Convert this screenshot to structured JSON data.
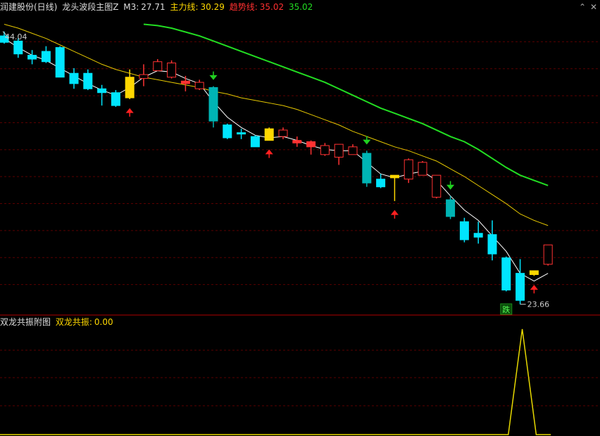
{
  "main_header": {
    "stock": "润建股份(日线)",
    "indicator": "龙头波段主图Z",
    "m3_label": "M3:",
    "m3_value": "27.71",
    "main_label": "主力线:",
    "main_value": "30.29",
    "trend_label": "趋势线:",
    "trend_value": "35.02",
    "trend_value2": "35.02"
  },
  "sub_header": {
    "title": "双龙共振附图",
    "label": "双龙共振:",
    "value": "0.00"
  },
  "colors": {
    "bull": "#ff3232",
    "bear": "#00e5ff",
    "bear_dark": "#00b4b4",
    "breakout": "#ffd700",
    "ma_white": "#ffffff",
    "ma_yellow": "#e6c800",
    "ma_green": "#22dd22",
    "grid": "#5a0000",
    "signal_up": "#ff2020",
    "signal_down": "#20d020"
  },
  "chart_data": {
    "type": "candlestick",
    "y_range": [
      22.5,
      45.5
    ],
    "price_high_label": "44.04",
    "price_low_label": "23.66",
    "fall_badge": "跌",
    "candles": [
      {
        "o": 43.7,
        "c": 43.2,
        "h": 44.04,
        "l": 43.1,
        "k": "bear"
      },
      {
        "o": 43.3,
        "c": 42.3,
        "h": 43.5,
        "l": 42.0,
        "k": "bear"
      },
      {
        "o": 42.2,
        "c": 41.9,
        "h": 42.6,
        "l": 41.5,
        "k": "bear"
      },
      {
        "o": 42.5,
        "c": 41.7,
        "h": 42.9,
        "l": 41.6,
        "k": "bear"
      },
      {
        "o": 42.8,
        "c": 40.5,
        "h": 42.9,
        "l": 40.5,
        "k": "bear"
      },
      {
        "o": 40.8,
        "c": 40.0,
        "h": 41.2,
        "l": 39.6,
        "k": "bear"
      },
      {
        "o": 40.8,
        "c": 39.6,
        "h": 41.1,
        "l": 39.5,
        "k": "bear"
      },
      {
        "o": 39.6,
        "c": 39.3,
        "h": 39.9,
        "l": 38.3,
        "k": "bear"
      },
      {
        "o": 39.3,
        "c": 38.3,
        "h": 39.5,
        "l": 38.2,
        "k": "bear"
      },
      {
        "o": 38.9,
        "c": 40.5,
        "h": 41.1,
        "l": 38.8,
        "k": "breakout"
      },
      {
        "o": 40.4,
        "c": 40.7,
        "h": 41.5,
        "l": 39.8,
        "k": "bull"
      },
      {
        "o": 41.0,
        "c": 41.7,
        "h": 41.9,
        "l": 41.0,
        "k": "bull"
      },
      {
        "o": 41.6,
        "c": 40.5,
        "h": 41.8,
        "l": 40.4,
        "k": "bear_hollow"
      },
      {
        "o": 40.2,
        "c": 40.0,
        "h": 40.6,
        "l": 39.4,
        "k": "bull_thin"
      },
      {
        "o": 39.6,
        "c": 40.1,
        "h": 40.3,
        "l": 39.5,
        "k": "bull"
      },
      {
        "o": 39.7,
        "c": 37.1,
        "h": 39.8,
        "l": 36.6,
        "k": "bear_dark"
      },
      {
        "o": 36.8,
        "c": 35.8,
        "h": 36.9,
        "l": 35.7,
        "k": "bear"
      },
      {
        "o": 36.2,
        "c": 36.1,
        "h": 36.5,
        "l": 35.7,
        "k": "bear"
      },
      {
        "o": 35.9,
        "c": 35.1,
        "h": 36.0,
        "l": 35.1,
        "k": "bear"
      },
      {
        "o": 35.6,
        "c": 36.5,
        "h": 36.6,
        "l": 35.6,
        "k": "breakout"
      },
      {
        "o": 35.9,
        "c": 36.4,
        "h": 36.6,
        "l": 35.7,
        "k": "bull"
      },
      {
        "o": 35.6,
        "c": 35.4,
        "h": 35.9,
        "l": 35.1,
        "k": "bull_thin"
      },
      {
        "o": 35.5,
        "c": 35.1,
        "h": 35.6,
        "l": 34.5,
        "k": "bull_thin"
      },
      {
        "o": 35.2,
        "c": 34.5,
        "h": 35.4,
        "l": 34.4,
        "k": "bear_hollow"
      },
      {
        "o": 34.3,
        "c": 35.3,
        "h": 35.3,
        "l": 33.7,
        "k": "bull"
      },
      {
        "o": 34.5,
        "c": 35.1,
        "h": 35.3,
        "l": 34.5,
        "k": "bull"
      },
      {
        "o": 34.6,
        "c": 32.3,
        "h": 34.8,
        "l": 32.0,
        "k": "bear_dark"
      },
      {
        "o": 32.6,
        "c": 32.0,
        "h": 33.0,
        "l": 31.9,
        "k": "bear"
      },
      {
        "o": 32.9,
        "c": 32.7,
        "h": 32.9,
        "l": 30.9,
        "k": "breakout"
      },
      {
        "o": 32.6,
        "c": 34.1,
        "h": 34.2,
        "l": 32.3,
        "k": "bull"
      },
      {
        "o": 33.9,
        "c": 32.9,
        "h": 34.0,
        "l": 32.9,
        "k": "bear_hollow"
      },
      {
        "o": 32.9,
        "c": 31.2,
        "h": 32.9,
        "l": 31.1,
        "k": "bear_hollow"
      },
      {
        "o": 31.0,
        "c": 29.7,
        "h": 31.3,
        "l": 29.5,
        "k": "bear_dark"
      },
      {
        "o": 29.3,
        "c": 27.9,
        "h": 29.6,
        "l": 27.7,
        "k": "bear"
      },
      {
        "o": 28.4,
        "c": 28.1,
        "h": 29.3,
        "l": 27.6,
        "k": "bear"
      },
      {
        "o": 28.3,
        "c": 26.8,
        "h": 29.4,
        "l": 26.3,
        "k": "bear"
      },
      {
        "o": 26.5,
        "c": 24.0,
        "h": 26.6,
        "l": 23.9,
        "k": "bear"
      },
      {
        "o": 25.3,
        "c": 23.2,
        "h": 26.4,
        "l": 22.9,
        "k": "bear"
      },
      {
        "o": 25.5,
        "c": 25.2,
        "h": 25.5,
        "l": 25.1,
        "k": "breakout"
      },
      {
        "o": 26.0,
        "c": 27.5,
        "h": 27.5,
        "l": 25.9,
        "k": "bull"
      }
    ],
    "ma_white": [
      43.5,
      42.8,
      42.2,
      41.8,
      41.2,
      40.6,
      40.0,
      39.5,
      39.1,
      39.7,
      40.5,
      41.0,
      40.9,
      40.4,
      40.0,
      38.6,
      37.4,
      36.6,
      36.0,
      35.8,
      35.9,
      35.6,
      35.2,
      34.9,
      34.8,
      34.8,
      33.9,
      33.0,
      32.7,
      33.0,
      33.2,
      32.5,
      31.3,
      30.2,
      29.4,
      28.2,
      27.0,
      25.3,
      24.7,
      25.3
    ],
    "ma_yellow": [
      44.6,
      44.3,
      43.9,
      43.5,
      43.0,
      42.5,
      42.0,
      41.5,
      41.1,
      40.8,
      40.5,
      40.3,
      40.1,
      39.9,
      39.7,
      39.4,
      39.2,
      38.9,
      38.7,
      38.5,
      38.3,
      38.0,
      37.6,
      37.2,
      36.8,
      36.3,
      35.9,
      35.5,
      35.1,
      34.8,
      34.4,
      34.0,
      33.4,
      32.8,
      32.1,
      31.4,
      30.7,
      29.9,
      29.4,
      29.0
    ],
    "ma_green": [
      [
        10,
        44.6
      ],
      [
        11,
        44.5
      ],
      [
        12,
        44.3
      ],
      [
        13,
        44.0
      ],
      [
        14,
        43.7
      ],
      [
        15,
        43.3
      ],
      [
        16,
        42.9
      ],
      [
        17,
        42.5
      ],
      [
        18,
        42.1
      ],
      [
        19,
        41.7
      ],
      [
        20,
        41.3
      ],
      [
        21,
        40.9
      ],
      [
        22,
        40.5
      ],
      [
        23,
        40.1
      ],
      [
        24,
        39.6
      ],
      [
        25,
        39.1
      ],
      [
        26,
        38.6
      ],
      [
        27,
        38.1
      ],
      [
        28,
        37.7
      ],
      [
        29,
        37.3
      ],
      [
        30,
        36.9
      ],
      [
        31,
        36.4
      ],
      [
        32,
        35.9
      ],
      [
        33,
        35.5
      ],
      [
        34,
        34.9
      ],
      [
        35,
        34.2
      ],
      [
        36,
        33.5
      ],
      [
        37,
        32.9
      ],
      [
        38,
        32.5
      ],
      [
        39,
        32.1
      ]
    ],
    "signals_up": [
      9,
      19,
      28,
      38
    ],
    "signals_down": [
      15,
      26,
      32
    ],
    "sub_series": {
      "x_range": [
        0,
        39
      ],
      "peak_index": 37,
      "values_nonzero": [
        [
          36,
          0
        ],
        [
          37,
          1
        ],
        [
          38,
          0
        ]
      ]
    }
  }
}
